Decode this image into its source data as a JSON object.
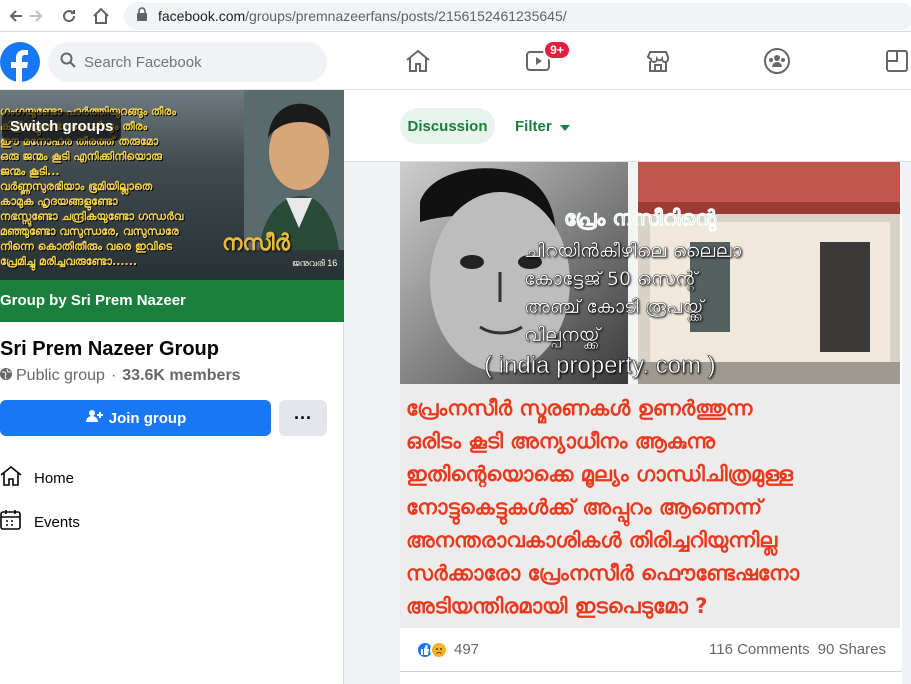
{
  "browser": {
    "url_host": "facebook.com",
    "url_path": "/groups/premnazeerfans/posts/2156152461235645/"
  },
  "topbar": {
    "search_placeholder": "Search Facebook",
    "watch_badge": "9+",
    "tabs": [
      "home-icon",
      "watch-icon",
      "marketplace-icon",
      "groups-icon",
      "gaming-icon"
    ]
  },
  "sidebar": {
    "switch_groups": "Switch groups",
    "banner": "Group by Sri Prem Nazeer",
    "group_name": "Sri Prem Nazeer Group",
    "privacy": "Public group",
    "separator": "·",
    "members": "33.6K members",
    "join_label": "Join group",
    "more_label": "···",
    "nav": [
      {
        "label": "Home",
        "icon": "home-outline-icon"
      },
      {
        "label": "Events",
        "icon": "calendar-icon"
      }
    ],
    "cover_text": "ഗംഗയുണ്ടോ പാർത്തിയുറങ്ങും തീരം\nകിളികളുണ്ടോ കോഴിയും തീരം\nഈ മനോഹര തീരത്ത് തരുമോ\nഒരു ജന്മം കൂടി എനിക്കിനിയൊരു\nജന്മം കൂടി...\nവർണ്ണസുരഭിയാം ഭൂമിയില്ലാതെ\nകാമുക ഹൃദയങ്ങളുണ്ടോ\nനഭസ്സുണ്ടോ ചന്ദ്രികയുണ്ടോ ഗന്ധർവ\nമഞ്ഞുണ്ടോ വസുന്ധരേ, വസുന്ധരേ\nനിന്നെ കൊതിതീരും വരെ ഇവിടെ\nപ്രേമിച്ചു മരിച്ചവരുണ്ടോ......",
    "cover_logo": "നസീർ",
    "cover_date": "ജനുവരി 16"
  },
  "feed": {
    "tab_discussion": "Discussion",
    "tab_filter": "Filter",
    "post": {
      "image_title": "പ്രേം നസീറിന്റെ",
      "image_lines": [
        "ചിറയിൻകീഴിലെ ലൈലാ",
        "കോട്ടേജ് 50 സെന്റ്",
        "അഞ്ച് കോടി രൂപയ്ക്ക്",
        "വില്പനയ്ക്ക്"
      ],
      "image_source": "( india property. com )",
      "image_red_text": [
        "പ്രേംനസീർ സ്മരണകൾ  ഉണർത്തുന്ന",
        "ഒരിടം കൂടി അന്യാധീനം  ആകുന്നു",
        "ഇതിന്റെയൊക്കെ മൂല്യം ഗാന്ധിചിത്രമുള്ള",
        "നോട്ടുകെട്ടുകൾക്ക്  അപ്പുറം ആണെന്ന്",
        "അനന്തരാവകാശികൾ തിരിച്ചറിയുന്നില്ല",
        "സർക്കാരോ  പ്രേംനസീർ  ഫൌണ്ടേഷനോ",
        "അടിയന്തിരമായി ഇടപെടുമോ ?"
      ],
      "reactions_count": "497",
      "comments": "116 Comments",
      "shares": "90 Shares"
    }
  },
  "colors": {
    "fb_blue": "#1877f2",
    "group_green": "#1a7f3c",
    "badge_red": "#e41e3f",
    "post_red_text": "#ea3a1e"
  }
}
